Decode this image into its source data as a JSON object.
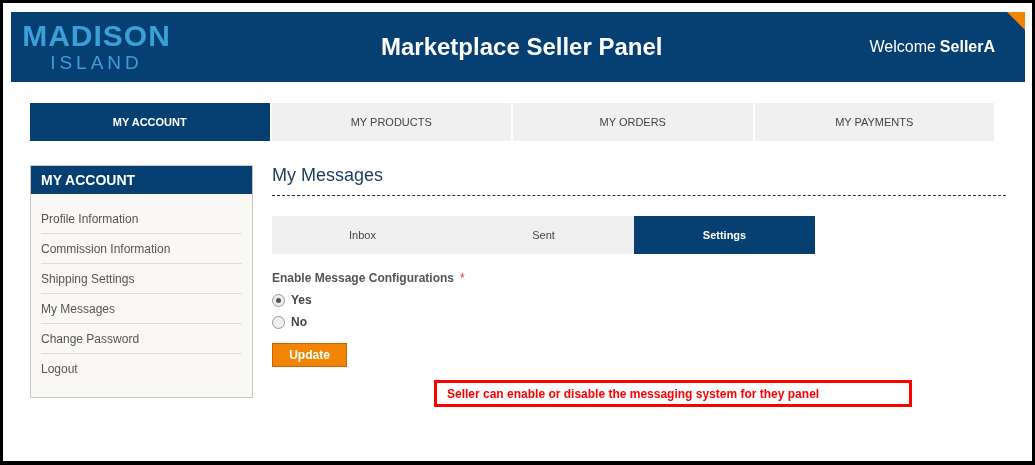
{
  "header": {
    "logo_top": "MADISON",
    "logo_bottom": "ISLAND",
    "title": "Marketplace Seller Panel",
    "welcome": "Welcome",
    "user": "SellerA"
  },
  "top_nav": [
    {
      "label": "MY ACCOUNT",
      "selected": true
    },
    {
      "label": "MY PRODUCTS",
      "selected": false
    },
    {
      "label": "MY ORDERS",
      "selected": false
    },
    {
      "label": "MY PAYMENTS",
      "selected": false
    }
  ],
  "sidebar": {
    "title": "MY ACCOUNT",
    "items": [
      "Profile Information",
      "Commission Information",
      "Shipping Settings",
      "My Messages",
      "Change Password",
      "Logout"
    ]
  },
  "content": {
    "title": "My Messages",
    "tabs": [
      {
        "label": "Inbox",
        "selected": false
      },
      {
        "label": "Sent",
        "selected": false
      },
      {
        "label": "Settings",
        "selected": true
      }
    ],
    "field_label": "Enable Message Configurations",
    "required_mark": "*",
    "options": [
      {
        "label": "Yes",
        "selected": true
      },
      {
        "label": "No",
        "selected": false
      }
    ],
    "button": "Update"
  },
  "annotation": "Seller can enable or disable the messaging system for they panel"
}
